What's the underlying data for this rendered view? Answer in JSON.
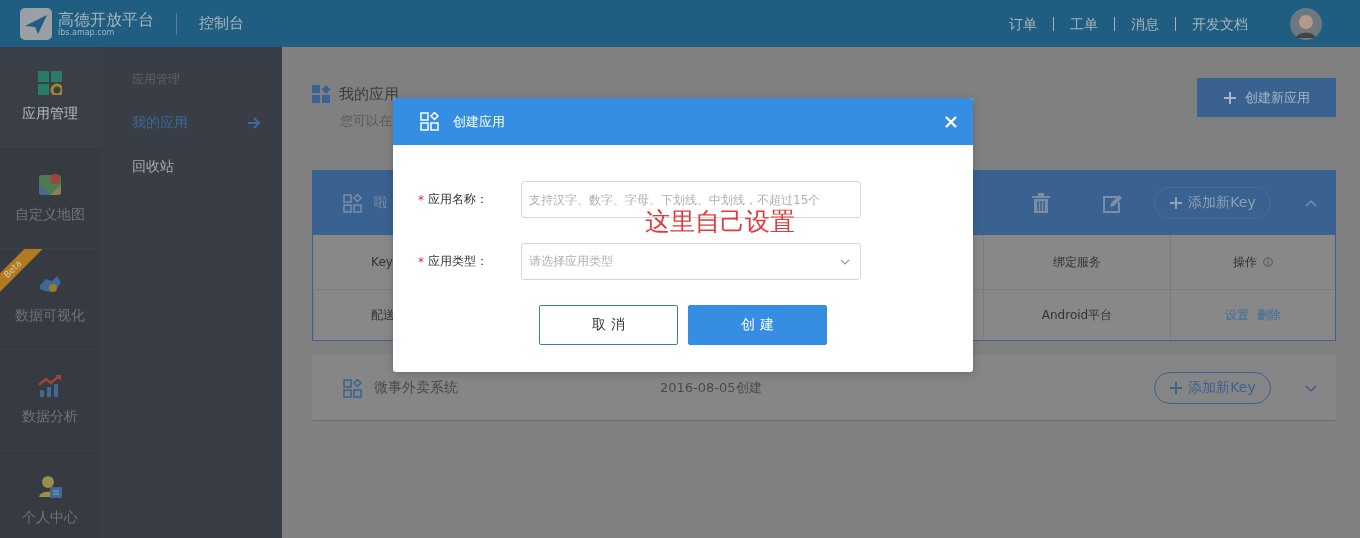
{
  "topbar": {
    "logo_title": "高德开放平台",
    "logo_url": "lbs.amap.com",
    "console": "控制台",
    "nav": [
      "订单",
      "工单",
      "消息",
      "开发文档"
    ]
  },
  "sidebar": {
    "items": [
      {
        "label": "应用管理",
        "selected": true
      },
      {
        "label": "自定义地图",
        "selected": false
      },
      {
        "label": "数据可视化",
        "selected": false,
        "badge": "Beta"
      },
      {
        "label": "数据分析",
        "selected": false
      },
      {
        "label": "个人中心",
        "selected": false
      }
    ]
  },
  "subnav": {
    "section": "应用管理",
    "items": [
      {
        "label": "我的应用",
        "selected": true
      },
      {
        "label": "回收站",
        "selected": false
      }
    ]
  },
  "main": {
    "title": "我的应用",
    "subtitle": "您可以在",
    "create_button": "创建新应用"
  },
  "apps": [
    {
      "name": "啦",
      "expanded": true,
      "add_key": "添加新Key",
      "table": {
        "columns": [
          {
            "label": "Key"
          },
          {
            "label": "绑定服务"
          },
          {
            "label": "操作",
            "info": true
          }
        ],
        "rows": [
          {
            "cells": [
              "配送",
              "Android平台"
            ],
            "actions": [
              "设置",
              "删除"
            ]
          }
        ]
      }
    },
    {
      "name": "微事外卖系统",
      "created": "2016-08-05创建",
      "expanded": false,
      "add_key": "添加新Key"
    }
  ],
  "dialog": {
    "title": "创建应用",
    "fields": [
      {
        "kind": "text",
        "label": "应用名称：",
        "required_mark": "*",
        "placeholder": "支持汉字、数字、字母、下划线、中划线，不超过15个"
      },
      {
        "kind": "select",
        "label": "应用类型：",
        "required_mark": "*",
        "placeholder": "请选择应用类型"
      }
    ],
    "buttons": [
      {
        "label": "取 消",
        "kind": "secondary"
      },
      {
        "label": "创 建",
        "kind": "primary"
      }
    ]
  },
  "annotation": "这里自己设置"
}
